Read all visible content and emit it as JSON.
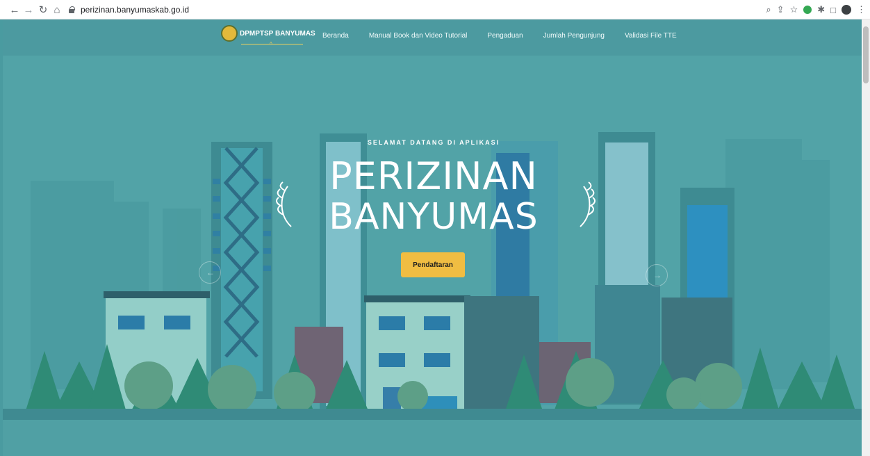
{
  "browser": {
    "url": "perizinan.banyumaskab.go.id"
  },
  "nav": {
    "brand": "DPMPTSP BANYUMAS",
    "links": [
      "Beranda",
      "Manual Book dan Video Tutorial",
      "Pengaduan",
      "Jumlah Pengunjung",
      "Validasi File TTE"
    ]
  },
  "hero": {
    "eyebrow": "SELAMAT DATANG DI APLIKASI",
    "title_line1": "PERIZINAN",
    "title_line2": "BANYUMAS",
    "cta": "Pendaftaran"
  },
  "colors": {
    "teal": "#52a3a7",
    "button": "#f0bd42",
    "white": "#ffffff"
  }
}
